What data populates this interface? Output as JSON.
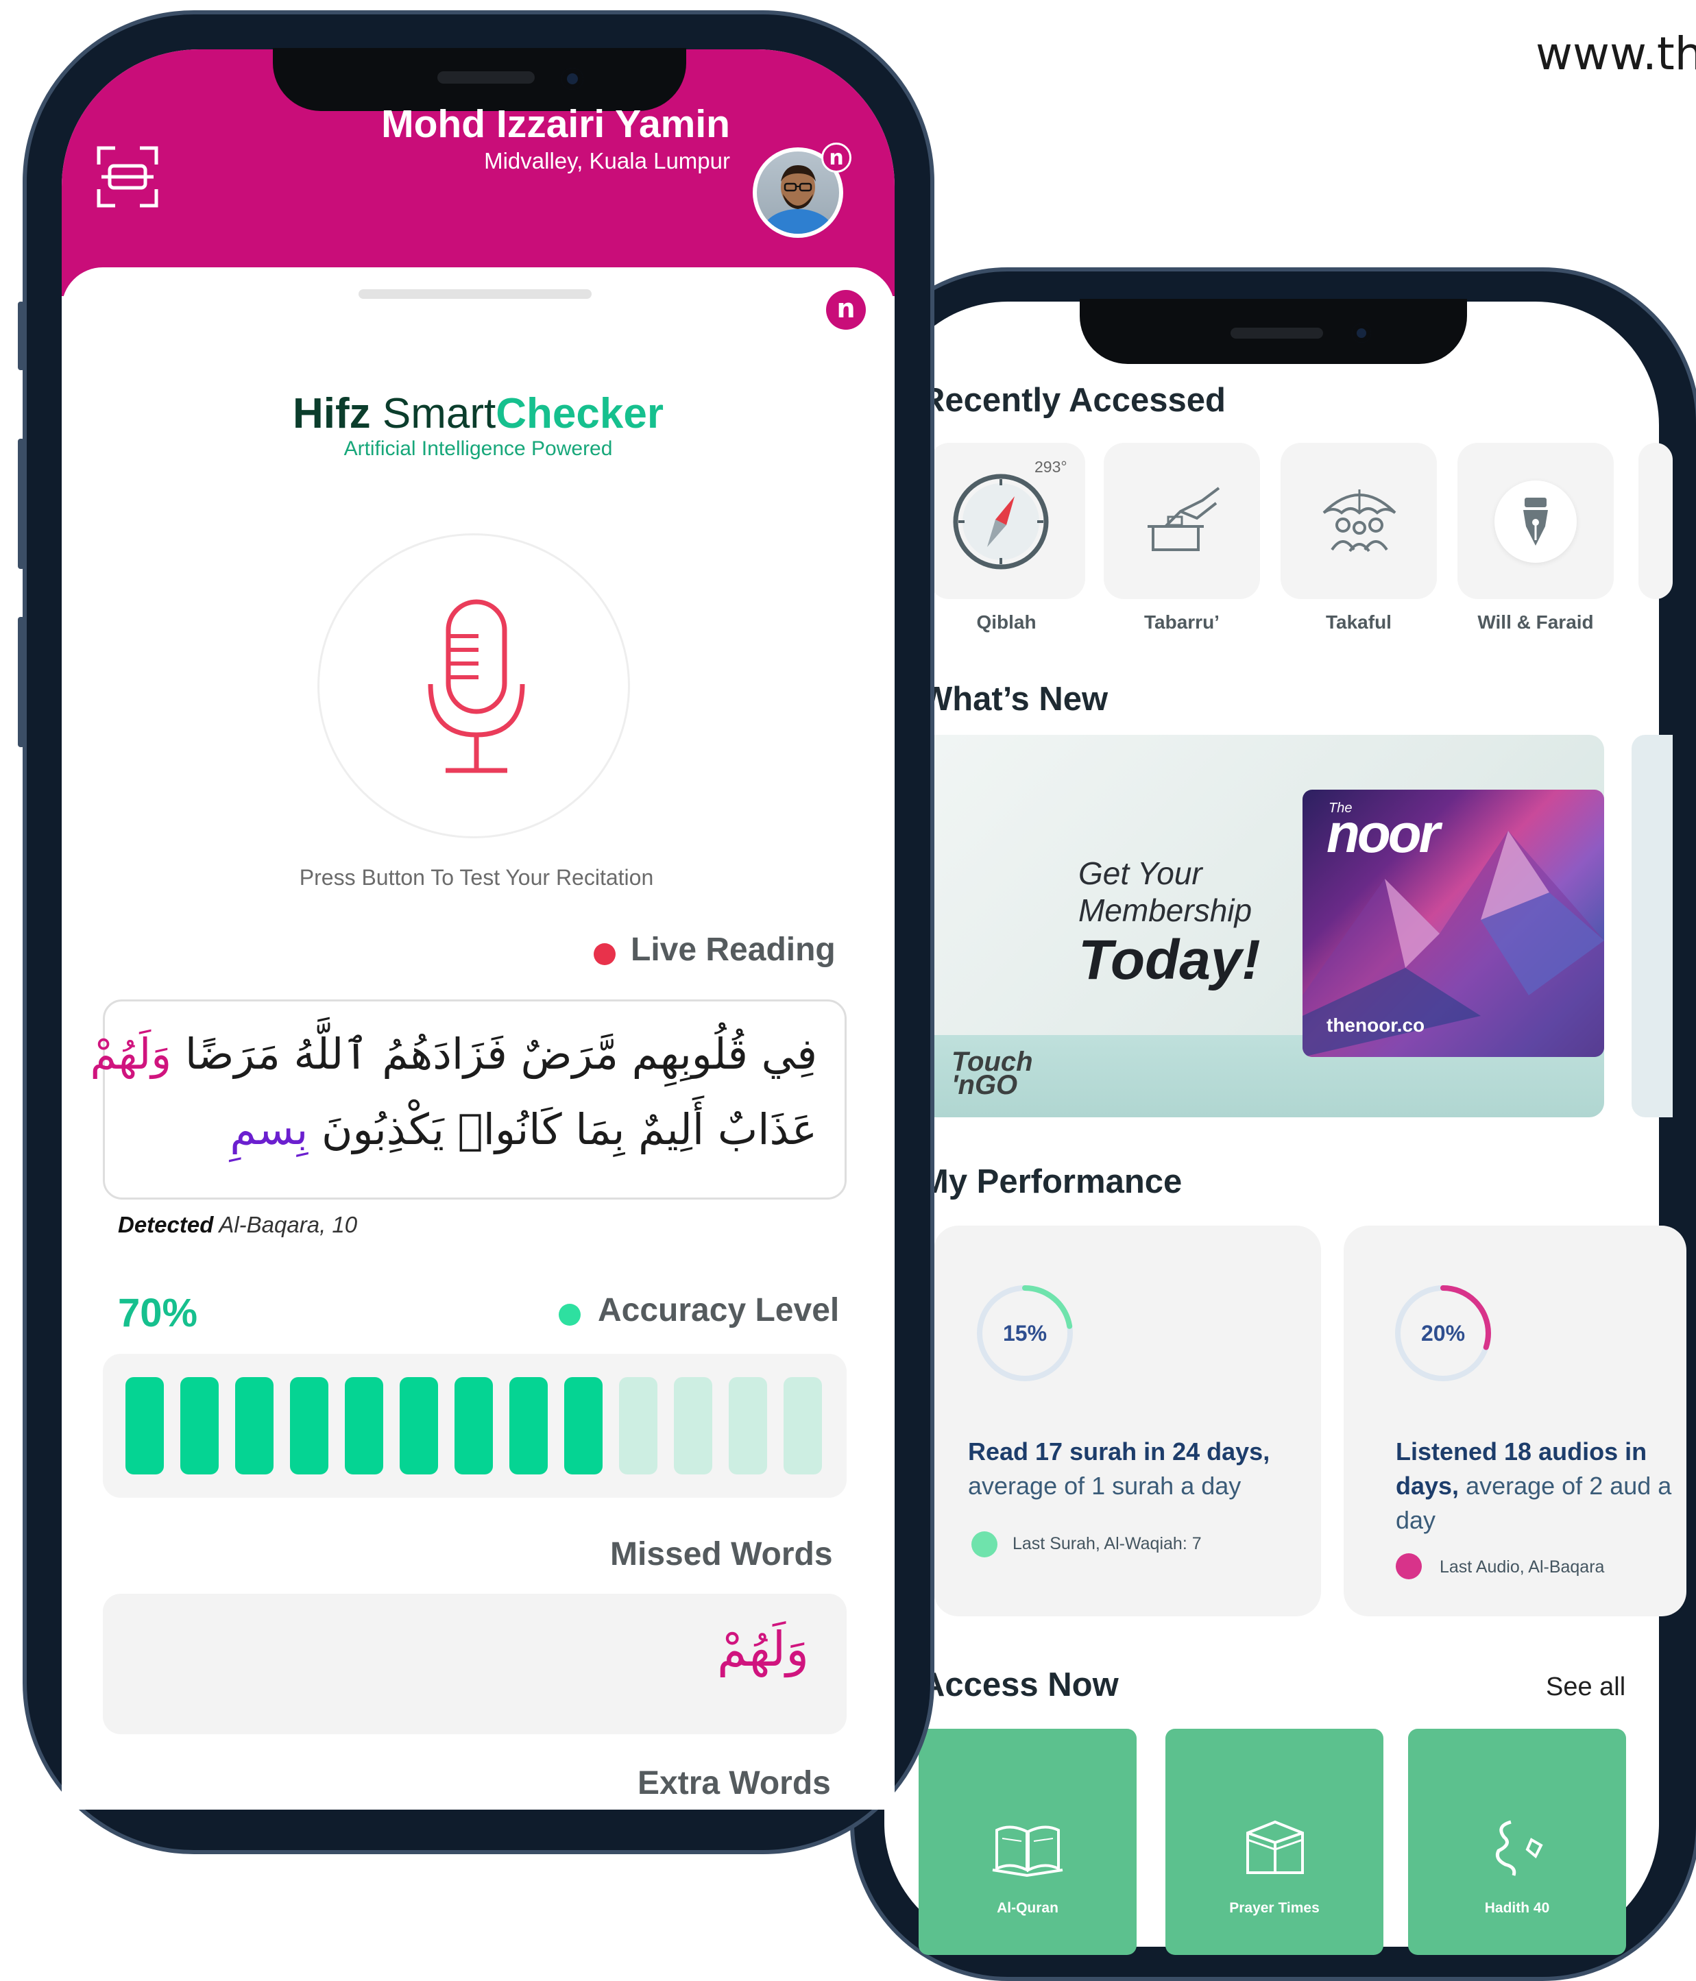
{
  "watermark_url": "www.the",
  "front": {
    "user": {
      "name": "Mohd Izzairi Yamin",
      "location": "Midvalley, Kuala Lumpur"
    },
    "badge_letter": "n",
    "app": {
      "title_bold": "Hifz",
      "title_mid": "Smart",
      "title_accent": "Checker",
      "subtitle": "Artificial Intelligence Powered"
    },
    "mic_prompt": "Press Button To Test Your Recitation",
    "live_reading_label": "Live Reading",
    "verse_line1_pink_end": "وَلَهُمْ",
    "verse_line1": "فِي قُلُوبِهِم مَّرَضٌ فَزَادَهُمُ ٱللَّهُ مَرَضًا",
    "verse_line2": "عَذَابٌ أَلِيمٌ بِمَا كَانُوا۟ يَكْذِبُونَ",
    "verse_line2_purple": "بِسمِ",
    "detected_label": "Detected",
    "detected_value": "Al-Baqara, 10",
    "accuracy_value": "70%",
    "accuracy_label": "Accuracy Level",
    "accuracy_filled": 9,
    "accuracy_total": 13,
    "missed_label": "Missed Words",
    "missed_word": "وَلَهُمْ",
    "extra_label": "Extra Words",
    "colors": {
      "brand": "#c90d79",
      "accent": "#16c08e",
      "live": "#e8324b"
    }
  },
  "back": {
    "recently_title": "Recently Accessed",
    "recent_items": [
      {
        "label": "Qiblah",
        "icon": "compass-icon",
        "meta": "293°"
      },
      {
        "label": "Tabarru’",
        "icon": "donation-hand-icon"
      },
      {
        "label": "Takaful",
        "icon": "umbrella-family-icon"
      },
      {
        "label": "Will & Faraid",
        "icon": "pen-nib-icon"
      }
    ],
    "whats_new_title": "What’s New",
    "banner": {
      "line1": "Get Your",
      "line2": "Membership",
      "line3": "Today!",
      "brand_top": "Touch",
      "brand_bottom": "'nGO",
      "card_the": "The",
      "card_logo": "noor",
      "card_url": "thenoor.co"
    },
    "performance_title": "My Performance",
    "performance": [
      {
        "percent": "15%",
        "progress": 0.15,
        "bold": "Read 17 surah in 24 days,",
        "rest": " average of 1 surah a day",
        "sub": "Last Surah, Al-Waqiah: 7",
        "color": "#6fe3ac"
      },
      {
        "percent": "20%",
        "progress": 0.2,
        "bold": "Listened 18 audios in days,",
        "rest": " average of 2 aud a day",
        "sub": "Last Audio, Al-Baqara",
        "color": "#d8338a"
      }
    ],
    "access_title": "Access Now",
    "see_all": "See all",
    "access_items": [
      {
        "label": "Al-Quran",
        "icon": "open-book-icon"
      },
      {
        "label": "Prayer Times",
        "icon": "kaaba-icon"
      },
      {
        "label": "Hadith 40",
        "icon": "arabic-calligraphy-icon"
      }
    ]
  }
}
